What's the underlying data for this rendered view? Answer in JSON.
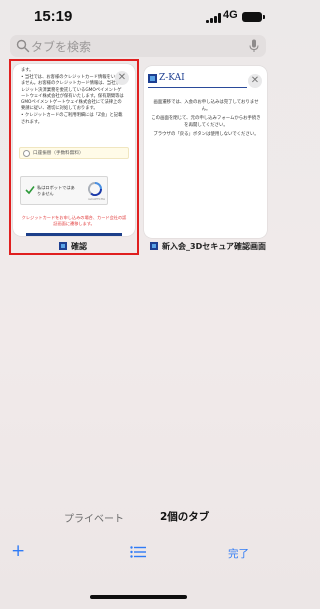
{
  "status": {
    "time": "15:19",
    "network": "4G"
  },
  "search": {
    "placeholder": "タブを検索",
    "icon": "search-icon",
    "mic_icon": "microphone-icon"
  },
  "tabs": [
    {
      "title": "確認",
      "selected": true,
      "content": {
        "paragraphs": [
          "ます。",
          "• 当社では、お客様のクレジットカード情報をいたしません。お客様のクレジットカード情報は、当社がクレジット決済業務を委託しているGMOペイメントゲートウェイ株式会社が保有いたします。保有期間等はGMOペイメントゲートウェイ株式会社にて法律上の要請に従い、適切に対処しております。",
          "• クレジットカードのご利用明細には「Z会」と記載されます。"
        ],
        "payment_option": "口座振替（手数料無料）",
        "captcha_label": "私はロボットではありません",
        "captcha_footer": "reCAPTCHA",
        "warning": "クレジットカードをお申し込みの場合、カード会社の認証画面に遷移します。"
      }
    },
    {
      "title": "新入会_3Dセキュア確認画面",
      "selected": false,
      "content": {
        "logo": "Z-KAI",
        "paragraphs": [
          "画面遷移では、入会のお申し込みは完了しておりません。",
          "この画面を閉じて、元の申し込みフォームからお手続きを再開してください。",
          "ブラウザの「戻る」ボタンは使用しないでください。"
        ]
      }
    }
  ],
  "bottom": {
    "private_label": "プライベート",
    "tab_count_label": "2個のタブ",
    "done_label": "完了",
    "add_icon": "plus-icon",
    "list_icon": "list-icon"
  },
  "colors": {
    "accent": "#2f7bf6",
    "selection": "#e01f1f",
    "brand": "#1e3f91"
  }
}
